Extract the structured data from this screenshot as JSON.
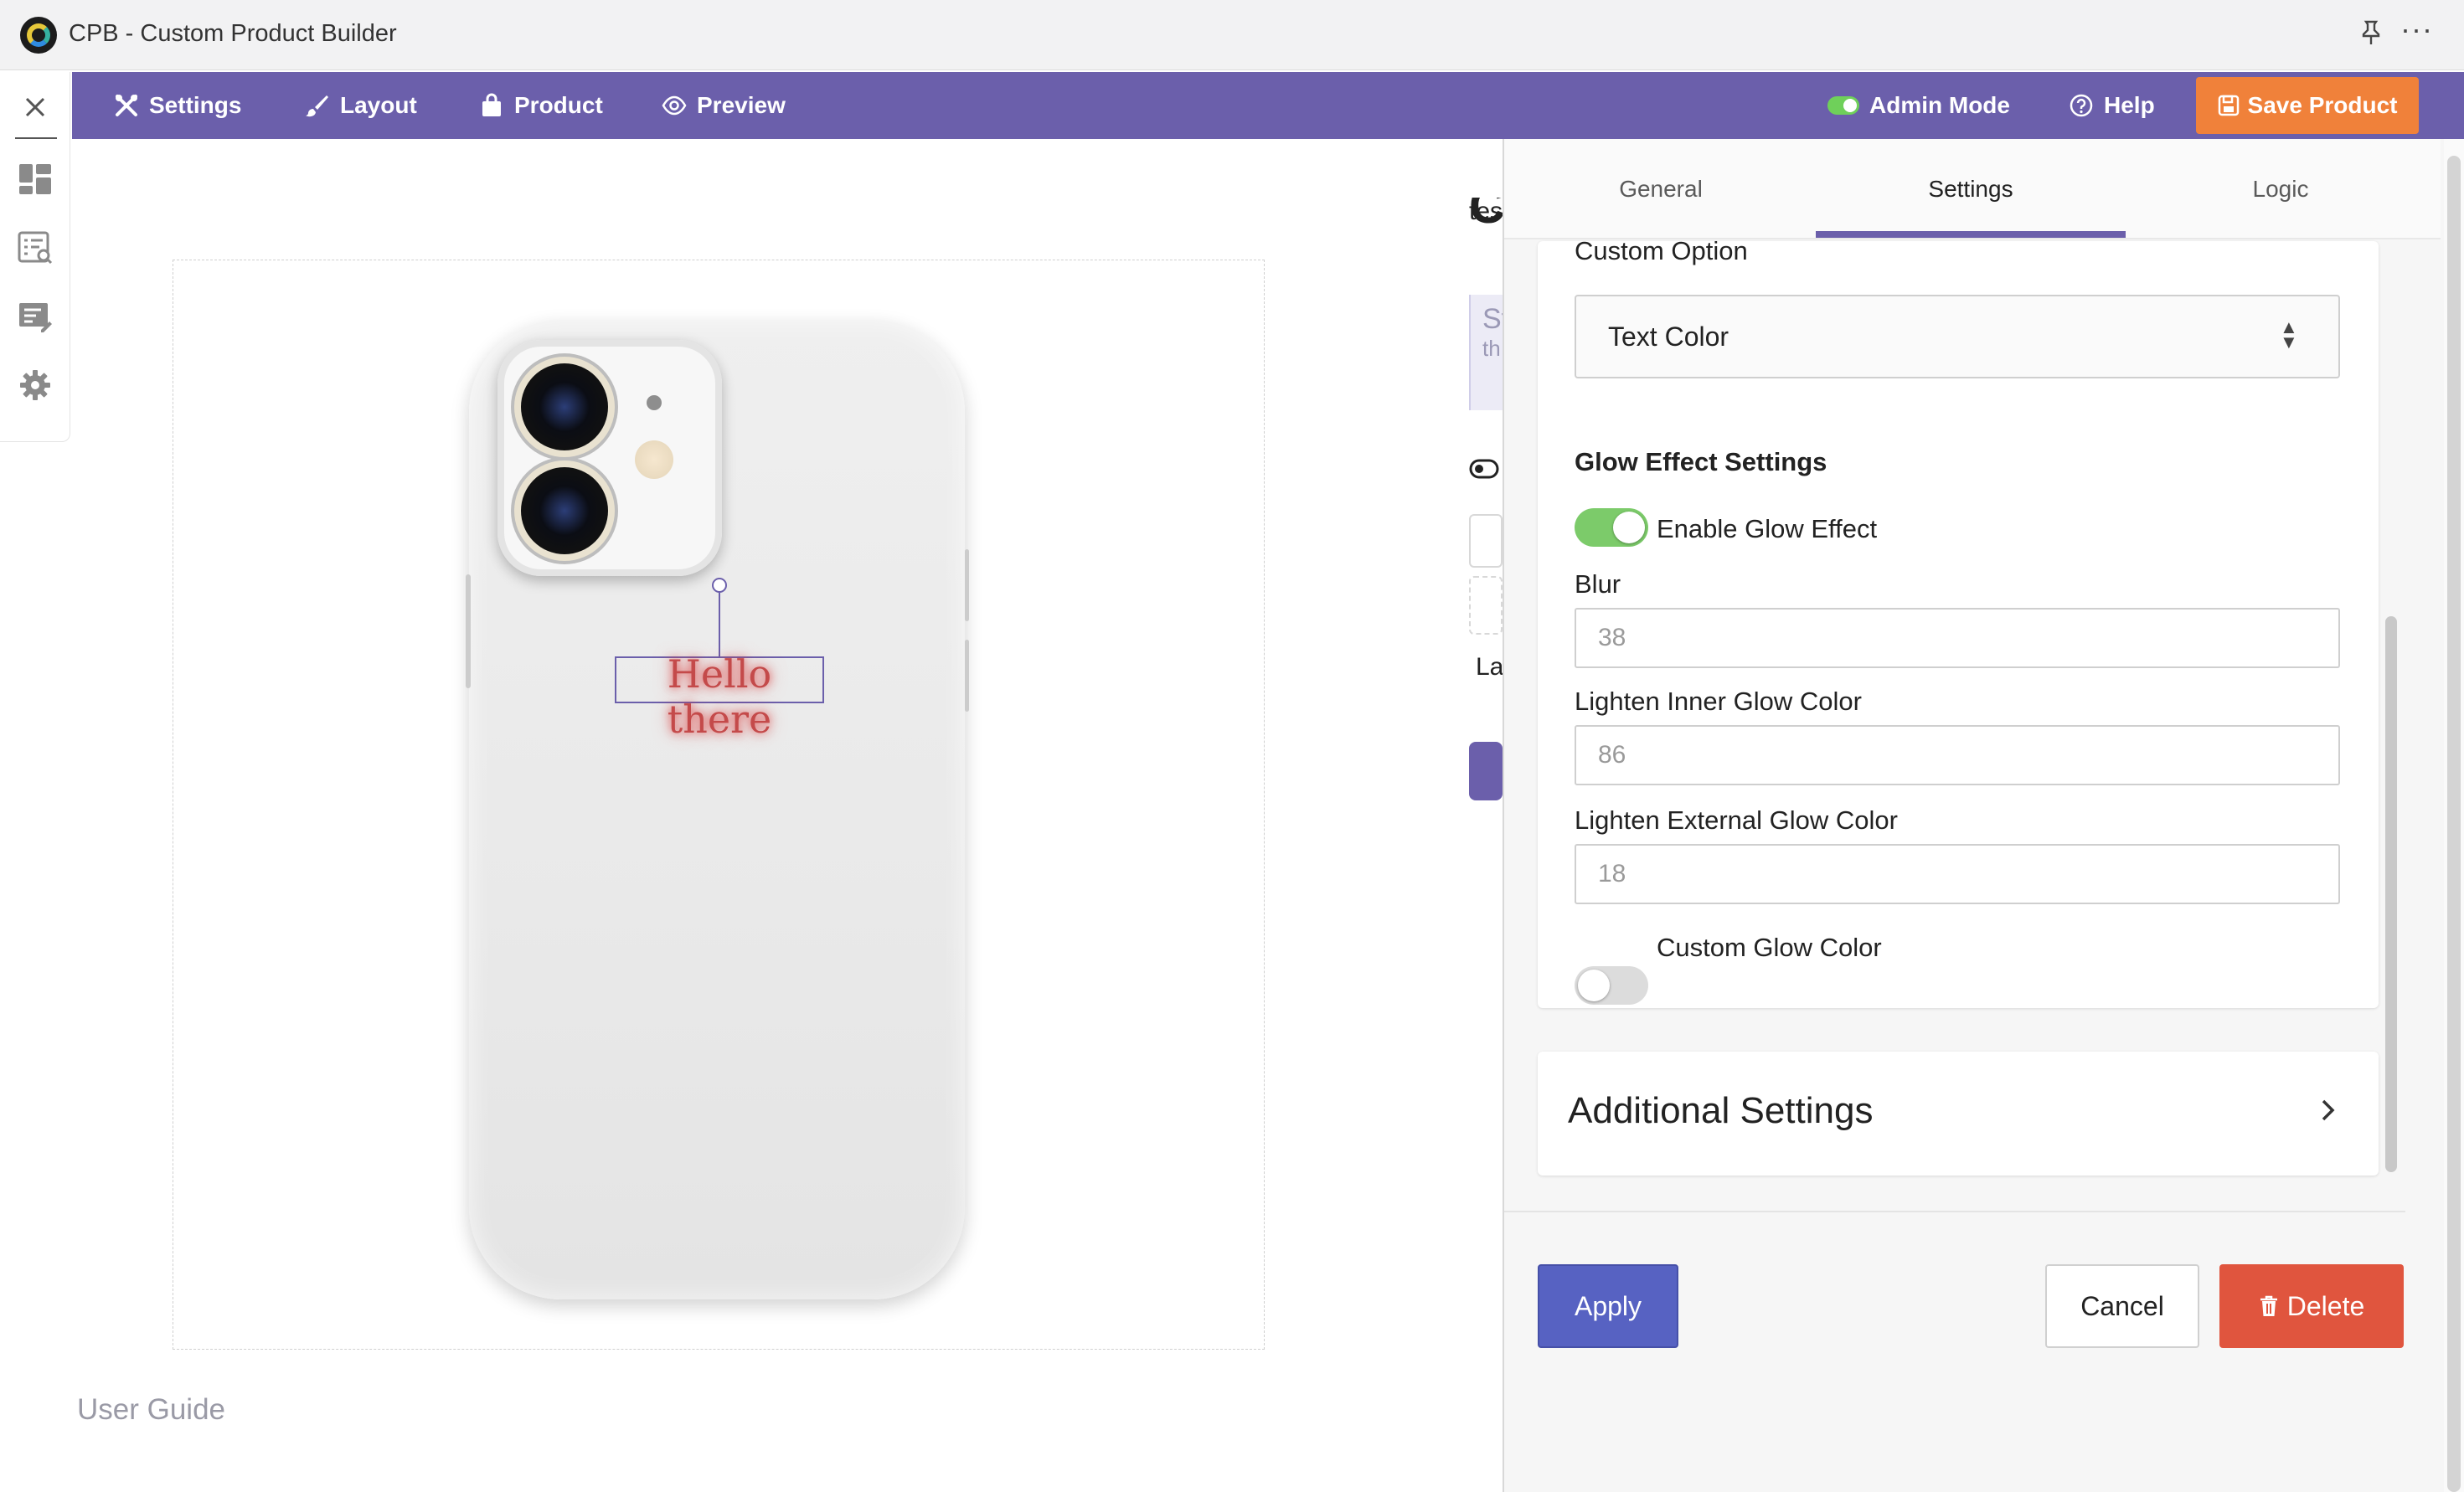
{
  "window": {
    "title": "CPB - Custom Product Builder"
  },
  "nav": {
    "settings": "Settings",
    "layout": "Layout",
    "product": "Product",
    "preview": "Preview",
    "admin_mode": "Admin Mode",
    "help": "Help",
    "save_product": "Save Product"
  },
  "canvas": {
    "text_layer": "Hello there"
  },
  "footer_link": "User Guide",
  "background_fragments": {
    "text1": "tes",
    "box_text1": "St",
    "box_text2": "th",
    "text2": "La"
  },
  "panel": {
    "tabs": [
      {
        "label": "General",
        "active": false
      },
      {
        "label": "Settings",
        "active": true
      },
      {
        "label": "Logic",
        "active": false
      }
    ],
    "custom_option_label": "Custom Option",
    "custom_option_value": "Text Color",
    "glow_section_title": "Glow Effect Settings",
    "enable_glow": {
      "label": "Enable Glow Effect",
      "on": true
    },
    "blur": {
      "label": "Blur",
      "value": "38"
    },
    "inner_glow": {
      "label": "Lighten Inner Glow Color",
      "value": "86"
    },
    "external_glow": {
      "label": "Lighten External Glow Color",
      "value": "18"
    },
    "custom_glow": {
      "label": "Custom Glow Color",
      "on": false
    },
    "additional_settings": "Additional Settings",
    "buttons": {
      "apply": "Apply",
      "cancel": "Cancel",
      "delete": "Delete"
    }
  },
  "colors": {
    "nav_bg": "#6b5fab",
    "save_button": "#f0813a",
    "apply_button": "#5762c2",
    "delete_button": "#e0553e",
    "toggle_on": "#7ccb6a",
    "glow_text": "#c44a4a"
  }
}
